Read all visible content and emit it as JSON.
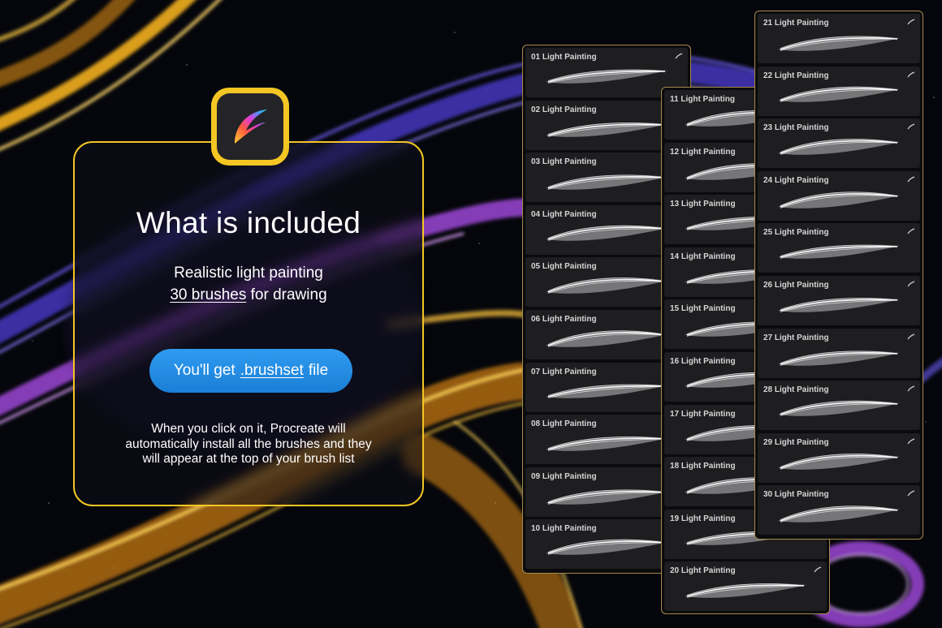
{
  "card": {
    "title": "What is included",
    "line1": "Realistic light painting",
    "line2_underlined": "30 brushes",
    "line2_rest": "for drawing",
    "button_prefix": "You'll get",
    "button_underlined": ".brushset",
    "button_suffix": "file",
    "desc1": "When you click on it, Procreate will",
    "desc2": "automatically install all the brushes and they",
    "desc3": "will appear at the top of your brush list"
  },
  "app_icon": "procreate-app-icon",
  "colors": {
    "card_border": "#f3c623",
    "button": "#1e88e5",
    "panel_border": "#a48a4a",
    "item_bg": "#1e1e21"
  },
  "brushes": {
    "panel_a": [
      "01 Light Painting",
      "02 Light Painting",
      "03 Light Painting",
      "04 Light Painting",
      "05 Light Painting",
      "06 Light Painting",
      "07 Light Painting",
      "08 Light Painting",
      "09 Light Painting",
      "10 Light Painting"
    ],
    "panel_b": [
      "11 Light Painting",
      "12 Light Painting",
      "13 Light Painting",
      "14 Light Painting",
      "15 Light Painting",
      "16 Light Painting",
      "17 Light Painting",
      "18 Light Painting",
      "19 Light Painting",
      "20 Light Painting"
    ],
    "panel_c": [
      "21 Light Painting",
      "22 Light Painting",
      "23 Light Painting",
      "24 Light Painting",
      "25 Light Painting",
      "26 Light Painting",
      "27 Light Painting",
      "28 Light Painting",
      "29 Light Painting",
      "30 Light Painting"
    ]
  }
}
